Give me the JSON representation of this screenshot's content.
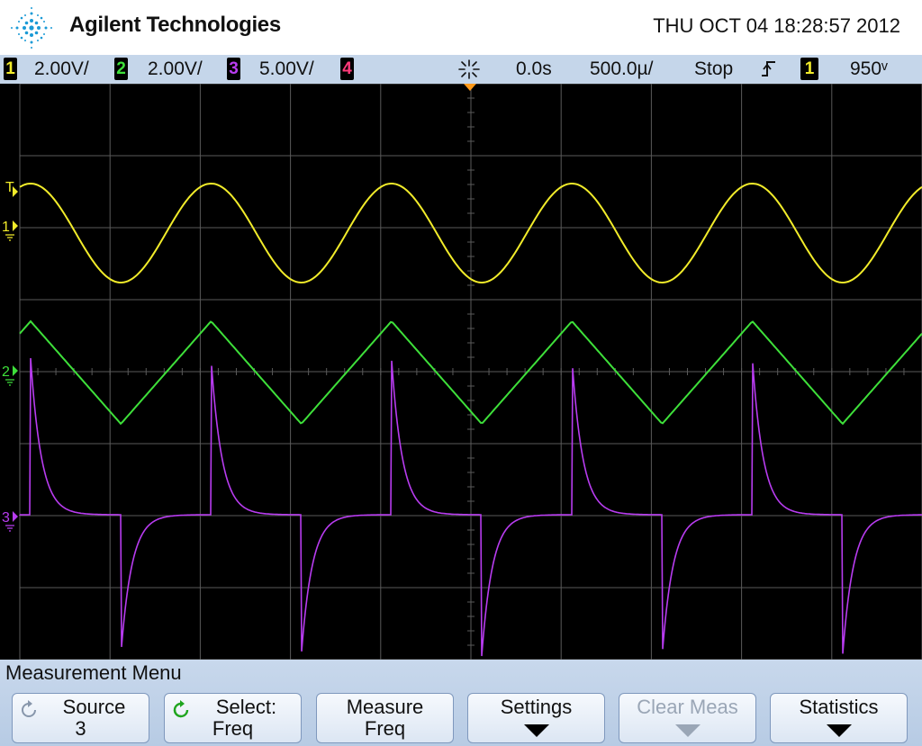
{
  "header": {
    "brand": "Agilent Technologies",
    "datetime": "THU OCT 04 18:28:57 2012"
  },
  "status": {
    "channels": [
      {
        "num": "1",
        "scale": "2.00V/",
        "color": "#f2ec2a"
      },
      {
        "num": "2",
        "scale": "2.00V/",
        "color": "#3ee03a"
      },
      {
        "num": "3",
        "scale": "5.00V/",
        "color": "#b83cf0"
      },
      {
        "num": "4",
        "scale": "",
        "color": "#ff3a7a"
      }
    ],
    "delay": "0.0s",
    "timebase": "500.0µ/",
    "run_state": "Stop",
    "trigger_source": "1",
    "trigger_level": "950ᵛ"
  },
  "scope": {
    "colors": {
      "grid": "#5a5a5a",
      "bg": "#000000",
      "ch1": "#f2ec2a",
      "ch2": "#3ee03a",
      "ch3": "#b83cf0",
      "trigger": "#ff9a1a"
    },
    "marker_trigger": "T",
    "marker_ch1": "1",
    "marker_ch2": "2",
    "marker_ch3": "3"
  },
  "menu": {
    "title": "Measurement Menu",
    "softkeys": [
      {
        "line1": "Source",
        "line2": "3",
        "icon": "rotate-knob-icon"
      },
      {
        "line1": "Select:",
        "line2": "Freq",
        "icon": "select-knob-icon"
      },
      {
        "line1": "Measure",
        "line2": "Freq"
      },
      {
        "line1": "Settings",
        "line2": "",
        "icon": "submenu-arrow-icon"
      },
      {
        "line1": "Clear Meas",
        "line2": "",
        "icon": "submenu-arrow-icon",
        "disabled": true
      },
      {
        "line1": "Statistics",
        "line2": "",
        "icon": "submenu-arrow-icon"
      }
    ]
  }
}
